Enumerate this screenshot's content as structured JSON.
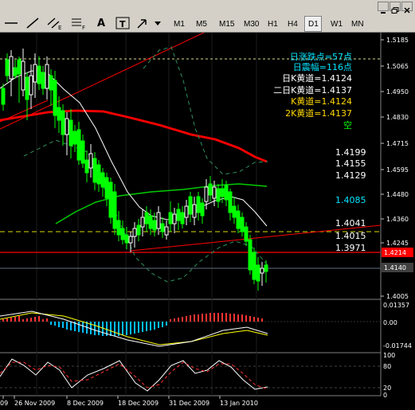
{
  "toolbar": {
    "timeframes": [
      "M1",
      "M5",
      "M15",
      "M30",
      "H1",
      "H4",
      "D1",
      "W1",
      "MN"
    ],
    "active_timeframe": "D1",
    "tools": [
      "hline-icon",
      "trendline-icon",
      "equidistant-channel-icon",
      "fibonacci-icon",
      "text-icon",
      "label-icon",
      "arrow-icon",
      "dropdown-arrow-icon"
    ],
    "text_tool_label": "A",
    "label_tool_label": "T"
  },
  "price_axis": [
    "1.5185",
    "1.5065",
    "1.4950",
    "1.4830",
    "1.4715",
    "1.4595",
    "1.4480",
    "1.4360",
    "1.4245",
    "1.4005"
  ],
  "price_badges": {
    "red": "1.4214",
    "dark": "1.4140"
  },
  "time_axis": [
    "09",
    "26 Nov 2009",
    "8 Dec 2009",
    "18 Dec 2009",
    "31 Dec 2009",
    "13 Jan 2010"
  ],
  "annotations": [
    {
      "text": "日涨跌点=57点",
      "color": "#00e5ff"
    },
    {
      "text": "日震幅=116点",
      "color": "#00e5ff"
    },
    {
      "text": "日K黄道=1.4124",
      "color": "#ffffff"
    },
    {
      "text": "二日K黄道=1.4137",
      "color": "#ffffff"
    },
    {
      "text": "K黄道=1.4124",
      "color": "#ffd700"
    },
    {
      "text": "2K黄道=1.4137",
      "color": "#ffd700"
    },
    {
      "text": "空",
      "color": "#00ff00"
    }
  ],
  "levels": [
    {
      "text": "1.4199",
      "color": "#ffffff"
    },
    {
      "text": "1.4155",
      "color": "#ffffff"
    },
    {
      "text": "1.4129",
      "color": "#ffffff"
    },
    {
      "text": "1.4085",
      "color": "#00e5ff"
    },
    {
      "text": "1.4041",
      "color": "#ffffff"
    },
    {
      "text": "1.4015",
      "color": "#ffffff"
    },
    {
      "text": "1.3971",
      "color": "#ffffff"
    }
  ],
  "macd_axis": [
    "0.01357",
    "0.00",
    "-0.01744"
  ],
  "osc_axis": [
    "100",
    "80",
    "20",
    "0"
  ],
  "colors": {
    "bull": "#ffffff",
    "bear": "#00ff00",
    "ma_fast": "#ffffff",
    "ma_mid": "#00cc00",
    "ma_slow": "#ff0000",
    "trend": "#ff0000",
    "macd_hist_pos": "#ff3333",
    "macd_hist_neg": "#00bfff",
    "signal": "#ffff00"
  }
}
